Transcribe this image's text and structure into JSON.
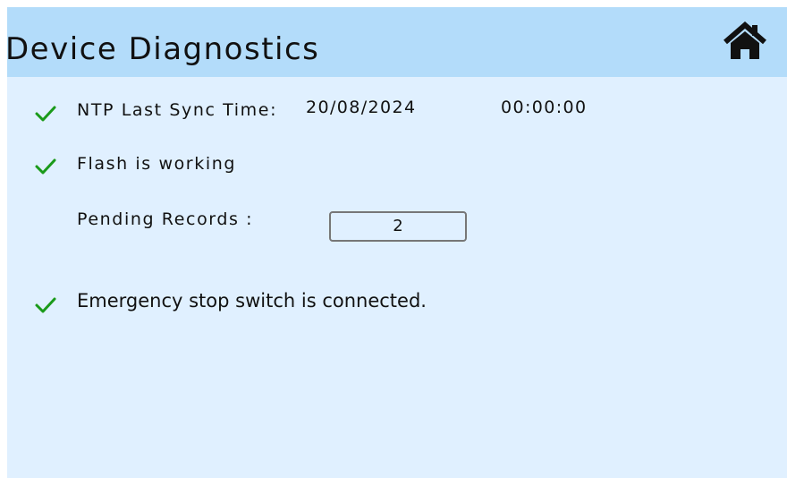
{
  "header": {
    "title": "Device Diagnostics",
    "home_icon": "home-icon"
  },
  "colors": {
    "header_bg": "#b3dcfa",
    "body_bg": "#e0f0ff",
    "check": "#1a9a1a"
  },
  "diagnostics": {
    "ntp": {
      "icon": "check-icon",
      "label": "NTP Last Sync Time:",
      "date": "20/08/2024",
      "time": "00:00:00"
    },
    "flash": {
      "icon": "check-icon",
      "label": "Flash is working",
      "pending_label": "Pending Records :",
      "pending_value": "2"
    },
    "estop": {
      "icon": "check-icon",
      "label": "Emergency stop switch is connected."
    }
  }
}
